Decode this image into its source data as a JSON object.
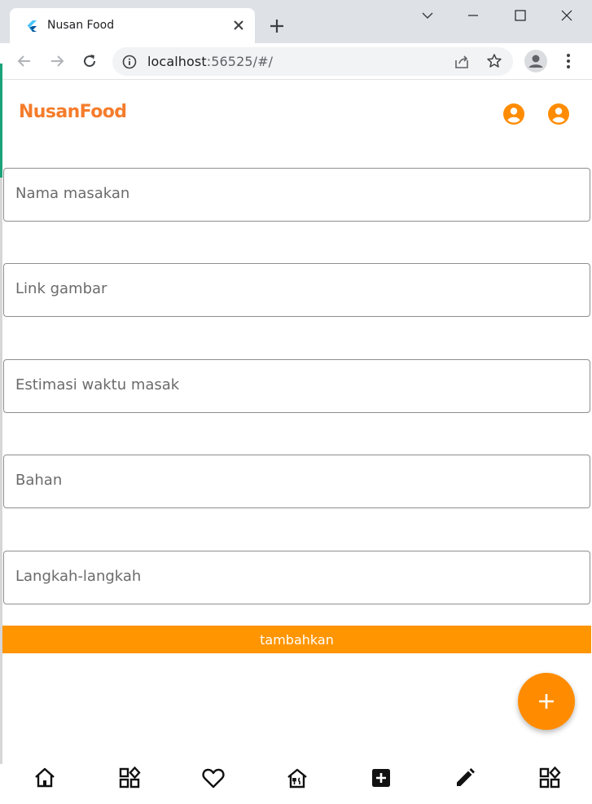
{
  "browser": {
    "tab_title": "Nusan Food",
    "url_host": "localhost",
    "url_rest": ":56525/#/"
  },
  "app": {
    "brand": "NusanFood",
    "colors": {
      "accent": "#ff9500",
      "brand": "#f57c2b",
      "fab": "#ff8c00"
    },
    "appbar_icons": [
      "account-circle-icon",
      "account-circle-icon"
    ],
    "form": {
      "fields": [
        {
          "placeholder": "Nama masakan",
          "value": ""
        },
        {
          "placeholder": "Link gambar",
          "value": ""
        },
        {
          "placeholder": "Estimasi waktu masak",
          "value": ""
        },
        {
          "placeholder": "Bahan",
          "value": ""
        },
        {
          "placeholder": "Langkah-langkah",
          "value": ""
        }
      ],
      "submit_label": "tambahkan"
    },
    "fab_icon": "add-icon",
    "bottom_nav": [
      "home-icon",
      "category-icon",
      "heart-icon",
      "restaurant-icon",
      "add-box-icon",
      "edit-icon",
      "category-icon"
    ]
  }
}
